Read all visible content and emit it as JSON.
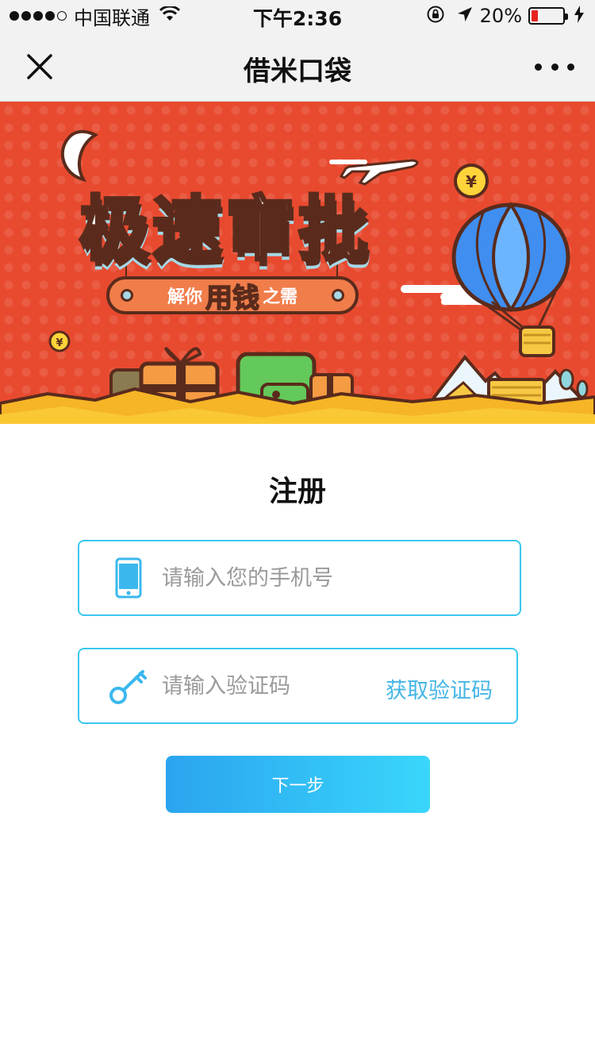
{
  "status_bar": {
    "carrier": "中国联通",
    "time": "下午2:36",
    "battery_percent": "20%",
    "battery_level": 0.2,
    "signal_bars": 4,
    "signal_max": 5,
    "battery_color": "#e8231f"
  },
  "nav": {
    "title": "借米口袋",
    "close_icon": "close-icon",
    "more_icon": "more-icon"
  },
  "banner": {
    "title": "极速审批",
    "subtitle_pre": "解你",
    "subtitle_highlight": "用钱",
    "subtitle_post": "之需"
  },
  "form": {
    "title": "注册",
    "phone_placeholder": "请输入您的手机号",
    "phone_value": "",
    "code_placeholder": "请输入验证码",
    "code_value": "",
    "get_code_label": "获取验证码",
    "next_label": "下一步",
    "accent_color": "#3ac8ee"
  }
}
